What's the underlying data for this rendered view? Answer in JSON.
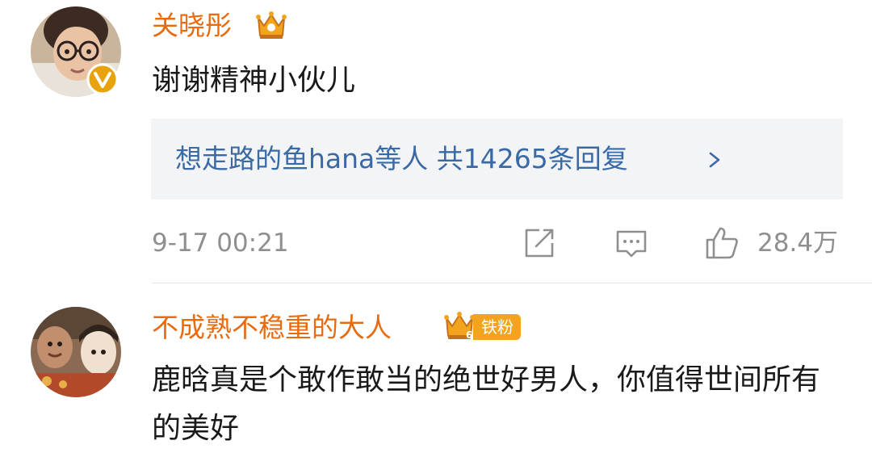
{
  "comments": [
    {
      "username": "关晓彤",
      "badge_icon": "crown-icon",
      "verified_icon": "verified-v-icon",
      "text": "谢谢精神小伙儿",
      "replies_summary": "想走路的鱼hana等人  共14265条回复",
      "timestamp": "9-17 00:21",
      "like_count": "28.4万"
    },
    {
      "username": "不成熟不稳重的大人",
      "badge_icon": "crown-icon",
      "badge_level": "6",
      "fan_label": "铁粉",
      "text": "鹿晗真是个敢作敢当的绝世好男人，你值得世间所有的美好"
    }
  ],
  "colors": {
    "username": "#e86b0f",
    "reply_link": "#3a6aa5",
    "meta_gray": "#8f8f8f",
    "badge_orange": "#f3a41f",
    "verified_bg": "#e8a20c"
  }
}
